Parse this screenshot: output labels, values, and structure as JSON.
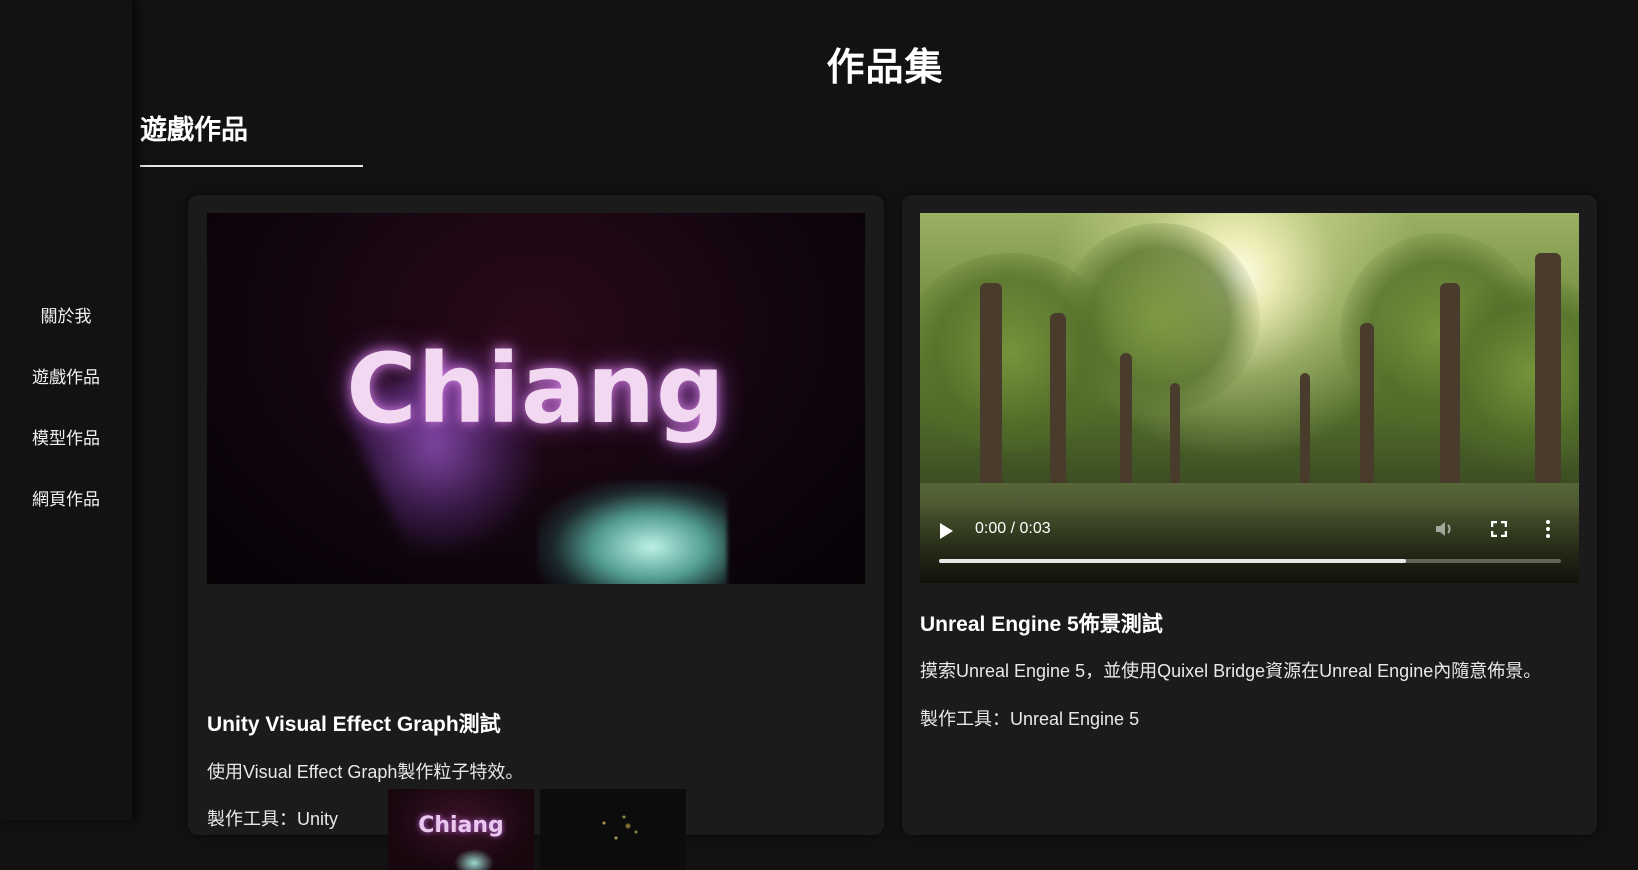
{
  "page_title": "作品集",
  "section_title": "遊戲作品",
  "sidebar": {
    "items": [
      {
        "label": "關於我"
      },
      {
        "label": "遊戲作品"
      },
      {
        "label": "模型作品"
      },
      {
        "label": "網頁作品"
      }
    ]
  },
  "cards": [
    {
      "media_text": "Chiang",
      "thumb_text": "Chiang",
      "title": "Unity Visual Effect Graph測試",
      "description": "使用Visual Effect Graph製作粒子特效。",
      "tools": "製作工具：Unity"
    },
    {
      "video": {
        "time": "0:00 / 0:03",
        "progress": 0.75
      },
      "title": "Unreal Engine 5佈景測試",
      "description": "摸索Unreal Engine 5，並使用Quixel Bridge資源在Unreal Engine內隨意佈景。",
      "tools": "製作工具：Unreal Engine 5"
    }
  ]
}
